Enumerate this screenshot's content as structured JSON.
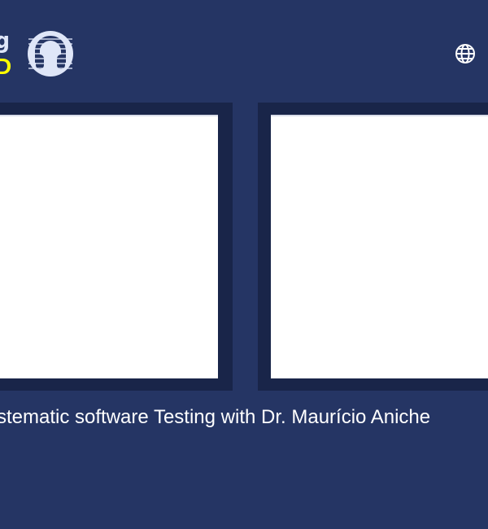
{
  "header": {
    "logo_text_top": "g",
    "logo_text_bottom": "D",
    "logo_mark_name": "headphones-logo",
    "language_icon": "globe-icon",
    "colors": {
      "background": "#253564",
      "accent": "#ffff00",
      "logo": "#dfe6f8"
    }
  },
  "main": {
    "episode_title": "ystematic software Testing with Dr. Maurício Aniche"
  }
}
